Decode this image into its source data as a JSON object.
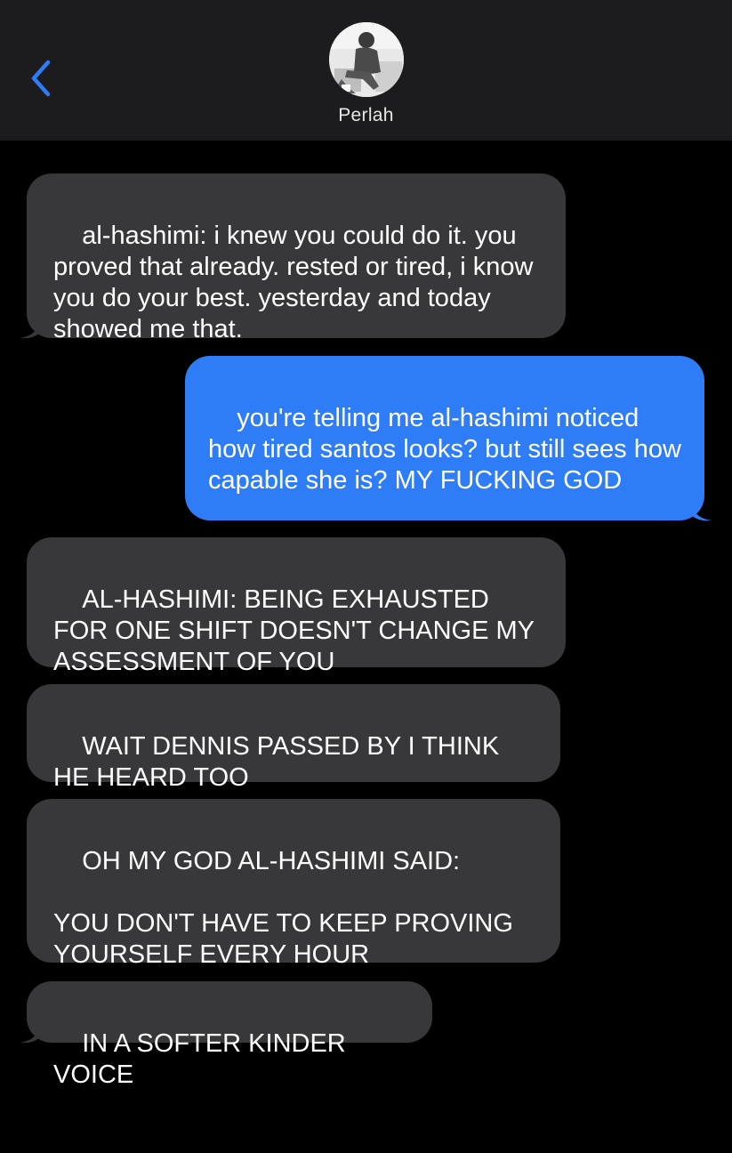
{
  "header": {
    "contact_name": "Perlah",
    "accent_color": "#2f7df6",
    "back_icon": "chevron-left-icon"
  },
  "messages": [
    {
      "direction": "incoming",
      "text": "al-hashimi: i knew you could do it. you proved that already. rested or tired, i know you do your best. yesterday and today showed me that."
    },
    {
      "direction": "outgoing",
      "text": "you're telling me al-hashimi noticed how tired santos looks? but still sees how capable she is? MY FUCKING GOD"
    },
    {
      "direction": "incoming",
      "text": "AL-HASHIMI: BEING EXHAUSTED FOR ONE SHIFT DOESN'T CHANGE MY ASSESSMENT OF YOU"
    },
    {
      "direction": "incoming",
      "text": "WAIT DENNIS PASSED BY I THINK HE HEARD TOO"
    },
    {
      "direction": "incoming",
      "text": "OH MY GOD AL-HASHIMI SAID:\n\nYOU DON'T HAVE TO KEEP PROVING YOURSELF EVERY HOUR"
    },
    {
      "direction": "incoming",
      "text": "IN A SOFTER KINDER VOICE"
    }
  ],
  "colors": {
    "incoming_bubble": "#38383a",
    "outgoing_bubble": "#2f7df6",
    "header_background": "#1c1c1e",
    "background": "#000000"
  }
}
